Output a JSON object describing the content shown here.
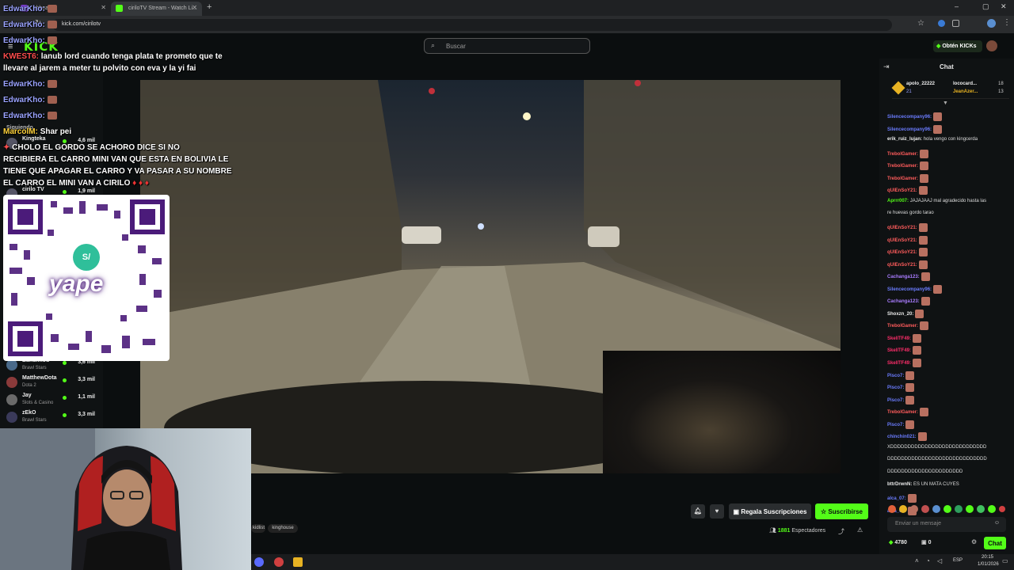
{
  "browser": {
    "tabs": [
      {
        "label": "shboard",
        "active": false
      },
      {
        "label": "ciriloTV Stream - Watch Li...",
        "active": true
      }
    ],
    "url": "kick.com/cirilotv"
  },
  "header": {
    "logo": "KICK",
    "search_placeholder": "Buscar",
    "kicks_button": "Obtén KICKs"
  },
  "sidebar": {
    "section": "Siguiendo",
    "items": [
      {
        "name": "Kingteka",
        "viewers": "4,6 mil",
        "game": ""
      },
      {
        "name": "cirilo TV",
        "viewers": "1,9 mil",
        "game": ""
      },
      {
        "name": "Bandimod",
        "viewers": "3,6 mil",
        "game": "Brawl Stars"
      },
      {
        "name": "MatthewDota",
        "viewers": "3,3 mil",
        "game": "Dota 2"
      },
      {
        "name": "Jay",
        "viewers": "1,1 mil",
        "game": "Slots & Casino"
      },
      {
        "name": "zEkO",
        "viewers": "3,3 mil",
        "game": "Brawl Stars"
      }
    ]
  },
  "overlay_chat": [
    {
      "user": "EdwarKho:",
      "text": ""
    },
    {
      "user": "EdwarKho:",
      "text": ""
    },
    {
      "user": "EdwarKho:",
      "text": ""
    },
    {
      "user": "KWEST6:",
      "text": "lanub lord cuando tenga plata te prometo que te"
    },
    {
      "user": "",
      "text": "llevare al jarem a meter tu polvito con eva y la yi fai"
    },
    {
      "user": "EdwarKho:",
      "text": ""
    },
    {
      "user": "EdwarKho:",
      "text": ""
    },
    {
      "user": "EdwarKho:",
      "text": ""
    },
    {
      "user": "MarcolM:",
      "text": "Shar pei"
    },
    {
      "user": "",
      "text": "CHOLO EL GORDO SE ACHORO DICE SI NO"
    },
    {
      "user": "",
      "text": "RECIBIERA EL CARRO MINI VAN QUE ESTA EN BOLIVIA LE"
    },
    {
      "user": "",
      "text": "TIENE QUE APAGAR EL CARRO Y VA PASAR A SU NOMBRE"
    },
    {
      "user": "",
      "text": "EL CARRO EL MINI VAN A CIRILO"
    }
  ],
  "qr": {
    "brand": "yape",
    "badge": "S/"
  },
  "stream": {
    "tags": [
      "kidlist",
      "kinghouse"
    ],
    "subscribe_gift_label": "Regala Suscripciones",
    "subscribe_label": "Suscribirse",
    "viewers_count": "1881",
    "viewers_label": "Espectadores"
  },
  "chat": {
    "title": "Chat",
    "top_gifters": [
      {
        "name": "apolo_22222",
        "count": "21"
      },
      {
        "name": "lococard...",
        "count": "18"
      },
      {
        "name": "JeanAzer...",
        "count": "13"
      }
    ],
    "messages": [
      {
        "user": "Silencecompany96:",
        "text": "",
        "color": "#6b7cff"
      },
      {
        "user": "Silencecompany96:",
        "text": "",
        "color": "#6b7cff"
      },
      {
        "user": "erik_ruiz_lujan:",
        "text": "hola vengo con kingcerda",
        "color": "#eaeaea"
      },
      {
        "user": "TrebolGamer:",
        "text": "",
        "color": "#ff5c5c"
      },
      {
        "user": "TrebolGamer:",
        "text": "",
        "color": "#ff5c5c"
      },
      {
        "user": "TrebolGamer:",
        "text": "",
        "color": "#ff5c5c"
      },
      {
        "user": "qUIEnSoY21:",
        "text": "",
        "color": "#ff5c5c"
      },
      {
        "user": "Aprrr007:",
        "text": "JAJAJAAJ mal agradecido hasta las",
        "color": "#53fc18"
      },
      {
        "user": "",
        "text": "re huevas gordo tarao",
        "color": "#eaeaea"
      },
      {
        "user": "qUIEnSoY21:",
        "text": "",
        "color": "#ff5c5c"
      },
      {
        "user": "qUIEnSoY21:",
        "text": "",
        "color": "#ff5c5c"
      },
      {
        "user": "qUIEnSoY21:",
        "text": "",
        "color": "#ff5c5c"
      },
      {
        "user": "qUIEnSoY21:",
        "text": "",
        "color": "#ff5c5c"
      },
      {
        "user": "Cachanga123:",
        "text": "",
        "color": "#a97cff"
      },
      {
        "user": "Silencecompany96:",
        "text": "",
        "color": "#6b7cff"
      },
      {
        "user": "Cachanga123:",
        "text": "",
        "color": "#a97cff"
      },
      {
        "user": "Shoxzn_20:",
        "text": "",
        "color": "#eaeaea"
      },
      {
        "user": "TrebolGamer:",
        "text": "",
        "color": "#ff5c5c"
      },
      {
        "user": "SkellTF49:",
        "text": "",
        "color": "#ff2d6a"
      },
      {
        "user": "SkellTF49:",
        "text": "",
        "color": "#ff2d6a"
      },
      {
        "user": "SkellTF49:",
        "text": "",
        "color": "#ff2d6a"
      },
      {
        "user": "Pisco7:",
        "text": "",
        "color": "#6b7cff"
      },
      {
        "user": "Pisco7:",
        "text": "",
        "color": "#6b7cff"
      },
      {
        "user": "Pisco7:",
        "text": "",
        "color": "#6b7cff"
      },
      {
        "user": "TrebolGamer:",
        "text": "",
        "color": "#ff5c5c"
      },
      {
        "user": "Pisco7:",
        "text": "",
        "color": "#6b7cff"
      },
      {
        "user": "chinchin021:",
        "text": "",
        "color": "#6b7cff"
      },
      {
        "user": "",
        "text": "XDDDDDDDDDDDDDDDDDDDDDDDDDDDD",
        "color": "#eaeaea"
      },
      {
        "user": "",
        "text": "DDDDDDDDDDDDDDDDDDDDDDDDDDDDD",
        "color": "#eaeaea"
      },
      {
        "user": "",
        "text": "DDDDDDDDDDDDDDDDDDDDDD",
        "color": "#eaeaea"
      },
      {
        "user": "bttrDrwnN:",
        "text": "ES UN MATA CUYES",
        "color": "#eaeaea"
      },
      {
        "user": "alca_07:",
        "text": "",
        "color": "#6b7cff"
      },
      {
        "user": "alca_07:",
        "text": "",
        "color": "#6b7cff"
      }
    ],
    "input_placeholder": "Enviar un mensaje",
    "kicks_count": "4780",
    "points": "0",
    "send_label": "Chat"
  },
  "taskbar": {
    "lang": "ESP",
    "time": "20:15",
    "date": "1/01/2026"
  }
}
